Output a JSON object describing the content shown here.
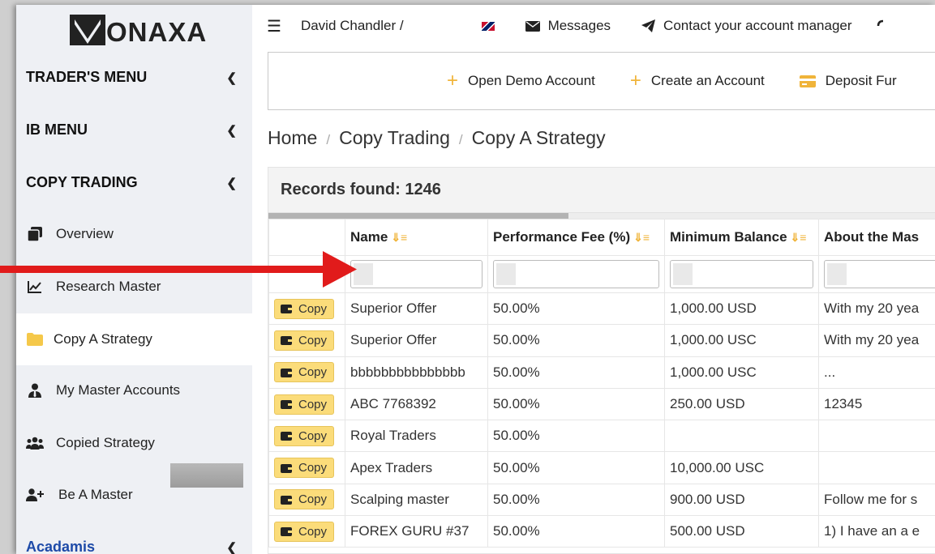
{
  "brand": {
    "logo_text": "ONAXA"
  },
  "topbar": {
    "user": "David Chandler /",
    "messages": "Messages",
    "contact": "Contact your account manager"
  },
  "sidebar": {
    "sections": [
      {
        "label": "TRADER'S MENU"
      },
      {
        "label": "IB MENU"
      },
      {
        "label": "COPY TRADING"
      }
    ],
    "items": [
      {
        "label": "Overview",
        "icon": "window-icon"
      },
      {
        "label": "Research Master",
        "icon": "chart-line-icon"
      },
      {
        "label": "Copy A Strategy",
        "icon": "folder-icon",
        "active": true
      },
      {
        "label": "My Master Accounts",
        "icon": "user-tie-icon"
      },
      {
        "label": "Copied Strategy",
        "icon": "users-icon"
      },
      {
        "label": "Be A Master",
        "icon": "user-plus-icon"
      }
    ],
    "bottom_section": "Acadamis"
  },
  "actions": {
    "open_demo": "Open Demo Account",
    "create_account": "Create an Account",
    "deposit": "Deposit Fur"
  },
  "breadcrumb": {
    "home": "Home",
    "section": "Copy Trading",
    "current": "Copy A Strategy"
  },
  "records_label": "Records found: 1246",
  "table": {
    "columns": [
      "Name",
      "Performance Fee (%)",
      "Minimum Balance",
      "About the Mas"
    ],
    "copy_label": "Copy",
    "rows": [
      {
        "name": "Superior Offer",
        "fee": "50.00%",
        "min": "1,000.00 USD",
        "about": "With my 20 yea"
      },
      {
        "name": "Superior Offer",
        "fee": "50.00%",
        "min": "1,000.00 USC",
        "about": "With my 20 yea"
      },
      {
        "name": "bbbbbbbbbbbbbbb",
        "fee": "50.00%",
        "min": "1,000.00 USC",
        "about": "..."
      },
      {
        "name": "ABC 7768392",
        "fee": "50.00%",
        "min": "250.00 USD",
        "about": "12345"
      },
      {
        "name": "Royal Traders",
        "fee": "50.00%",
        "min": "",
        "about": ""
      },
      {
        "name": "Apex Traders",
        "fee": "50.00%",
        "min": "10,000.00 USC",
        "about": ""
      },
      {
        "name": "Scalping master",
        "fee": "50.00%",
        "min": "900.00 USD",
        "about": "Follow me for s"
      },
      {
        "name": "FOREX GURU #37",
        "fee": "50.00%",
        "min": "500.00 USD",
        "about": "1) I have an a e"
      }
    ]
  },
  "colors": {
    "accent": "#f0b43a",
    "copy_button": "#fbdc7a",
    "annotation_arrow": "#e11b1b",
    "link_blue": "#1d4aa8"
  }
}
